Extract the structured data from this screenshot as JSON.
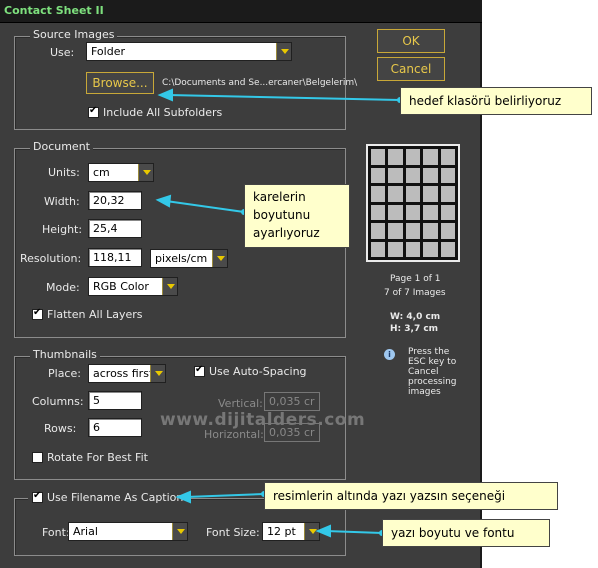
{
  "window": {
    "title": "Contact Sheet II"
  },
  "buttons": {
    "ok": "OK",
    "cancel": "Cancel",
    "browse": "Browse..."
  },
  "source": {
    "legend": "Source Images",
    "use_label": "Use:",
    "use_value": "Folder",
    "path": "C:\\Documents and Se...ercaner\\Belgelerim\\",
    "include_subfolders": "Include All Subfolders"
  },
  "document": {
    "legend": "Document",
    "units_label": "Units:",
    "units_value": "cm",
    "width_label": "Width:",
    "width_value": "20,32",
    "height_label": "Height:",
    "height_value": "25,4",
    "resolution_label": "Resolution:",
    "resolution_value": "118,11",
    "resolution_unit": "pixels/cm",
    "mode_label": "Mode:",
    "mode_value": "RGB Color",
    "flatten": "Flatten All Layers"
  },
  "thumbnails": {
    "legend": "Thumbnails",
    "place_label": "Place:",
    "place_value": "across first",
    "auto_spacing": "Use Auto-Spacing",
    "columns_label": "Columns:",
    "columns_value": "5",
    "rows_label": "Rows:",
    "rows_value": "6",
    "vertical_label": "Vertical:",
    "vertical_value": "0,035 cr",
    "horizontal_label": "Horizontal:",
    "horizontal_value": "0,035 cr",
    "rotate": "Rotate For Best Fit"
  },
  "caption": {
    "use_filename": "Use Filename As Caption",
    "font_label": "Font:",
    "font_value": "Arial",
    "fontsize_label": "Font Size:",
    "fontsize_value": "12 pt"
  },
  "preview": {
    "page": "Page 1 of 1",
    "images": "7 of 7 Images",
    "w": "W: 4,0 cm",
    "h": "H: 3,7 cm",
    "esc_note": [
      "Press the",
      "ESC key to",
      "Cancel",
      "processing",
      "images"
    ]
  },
  "watermark": "www.dijitalders.com",
  "callouts": {
    "folder": "hedef klasörü belirliyoruz",
    "size": [
      "karelerin",
      "boyutunu",
      "ayarlıyoruz"
    ],
    "caption": "resimlerin altında yazı yazsın seçeneği",
    "font": "yazı boyutu ve fontu"
  },
  "colors": {
    "bg": "#3d3d3d",
    "accent": "#e8c84a",
    "callout": "#ffffcc",
    "arrow": "#33c8e8"
  }
}
